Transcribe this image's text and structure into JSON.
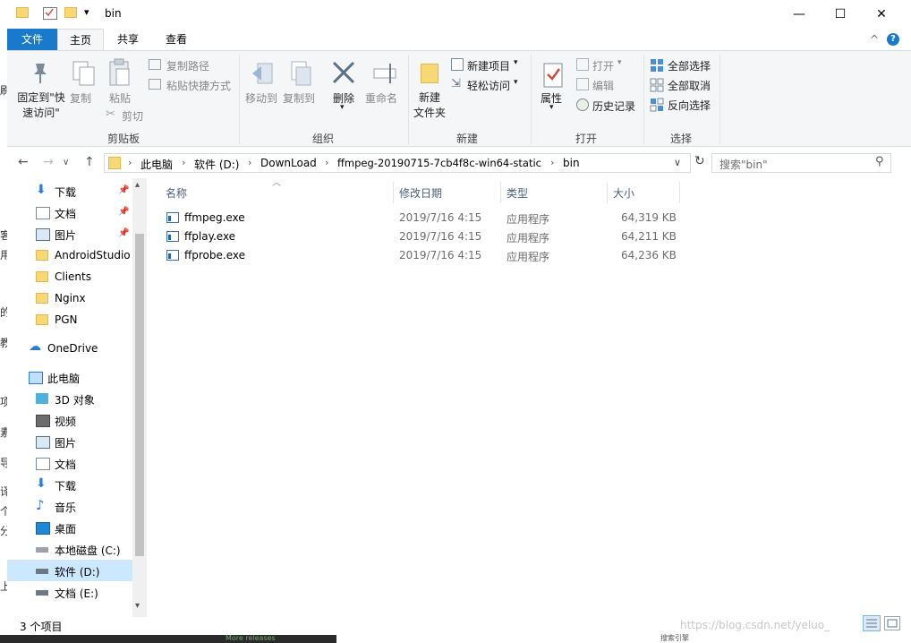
{
  "window": {
    "title": "bin",
    "minimize_glyph": "—",
    "maximize_glyph": "☐",
    "close_glyph": "✕",
    "qat_dropdown_glyph": "▾"
  },
  "ribbon_tabs": {
    "file": "文件",
    "home": "主页",
    "share": "共享",
    "view": "查看",
    "collapse_glyph": "^",
    "help_glyph": "?"
  },
  "ribbon": {
    "clipboard": {
      "pin_quick_access": "固定到\"快速访问\"",
      "copy": "复制",
      "paste": "粘贴",
      "copy_path": "复制路径",
      "paste_shortcut": "粘贴快捷方式",
      "cut": "剪切",
      "group_label": "剪贴板"
    },
    "organize": {
      "move_to": "移动到",
      "copy_to": "复制到",
      "delete": "删除",
      "rename": "重命名",
      "group_label": "组织"
    },
    "new": {
      "new_folder": "新建\n文件夹",
      "new_item": "新建项目",
      "easy_access": "轻松访问",
      "group_label": "新建"
    },
    "open": {
      "properties": "属性",
      "open": "打开",
      "edit": "编辑",
      "history": "历史记录",
      "group_label": "打开"
    },
    "select": {
      "select_all": "全部选择",
      "select_none": "全部取消",
      "invert": "反向选择",
      "group_label": "选择"
    }
  },
  "address": {
    "back_glyph": "←",
    "forward_glyph": "→",
    "recent_glyph": "∨",
    "up_glyph": "↑",
    "sep_glyph": "›",
    "crumbs": [
      "此电脑",
      "软件 (D:)",
      "DownLoad",
      "ffmpeg-20190715-7cb4f8c-win64-static",
      "bin"
    ],
    "dropdown_glyph": "∨",
    "refresh_glyph": "↻",
    "search_placeholder": "搜索\"bin\"",
    "search_glyph": "⚲"
  },
  "nav_pane": {
    "pin_glyph": "📌",
    "quick_access": [
      "下载",
      "文档",
      "图片",
      "AndroidStudio",
      "Clients",
      "Nginx",
      "PGN"
    ],
    "onedrive": "OneDrive",
    "this_pc": "此电脑",
    "pc_items": [
      "3D 对象",
      "视频",
      "图片",
      "文档",
      "下载",
      "音乐",
      "桌面",
      "本地磁盘 (C:)",
      "软件 (D:)",
      "文档 (E:)"
    ],
    "scroll_up_glyph": "▴",
    "scroll_down_glyph": "▾"
  },
  "columns": {
    "name": "名称",
    "modified": "修改日期",
    "type": "类型",
    "size": "大小",
    "sort_glyph": "︿"
  },
  "files": [
    {
      "name": "ffmpeg.exe",
      "modified": "2019/7/16 4:15",
      "type": "应用程序",
      "size": "64,319 KB"
    },
    {
      "name": "ffplay.exe",
      "modified": "2019/7/16 4:15",
      "type": "应用程序",
      "size": "64,211 KB"
    },
    {
      "name": "ffprobe.exe",
      "modified": "2019/7/16 4:15",
      "type": "应用程序",
      "size": "64,236 KB"
    }
  ],
  "status": {
    "item_count": "3 个项目"
  },
  "watermark": "https://blog.csdn.net/yeluo_",
  "background_text": {
    "left_chars": [
      "刷",
      "客",
      "用",
      "的",
      "教",
      "项",
      "素",
      "导",
      "译",
      "个",
      "分",
      "上"
    ],
    "bottom_left": "More releases",
    "bottom_right": "搜索引擎"
  },
  "colors": {
    "accent": "#1979ca",
    "ribbon_bg": "#f5f6f7",
    "selection": "#cce8ff",
    "folder": "#f8d775"
  }
}
